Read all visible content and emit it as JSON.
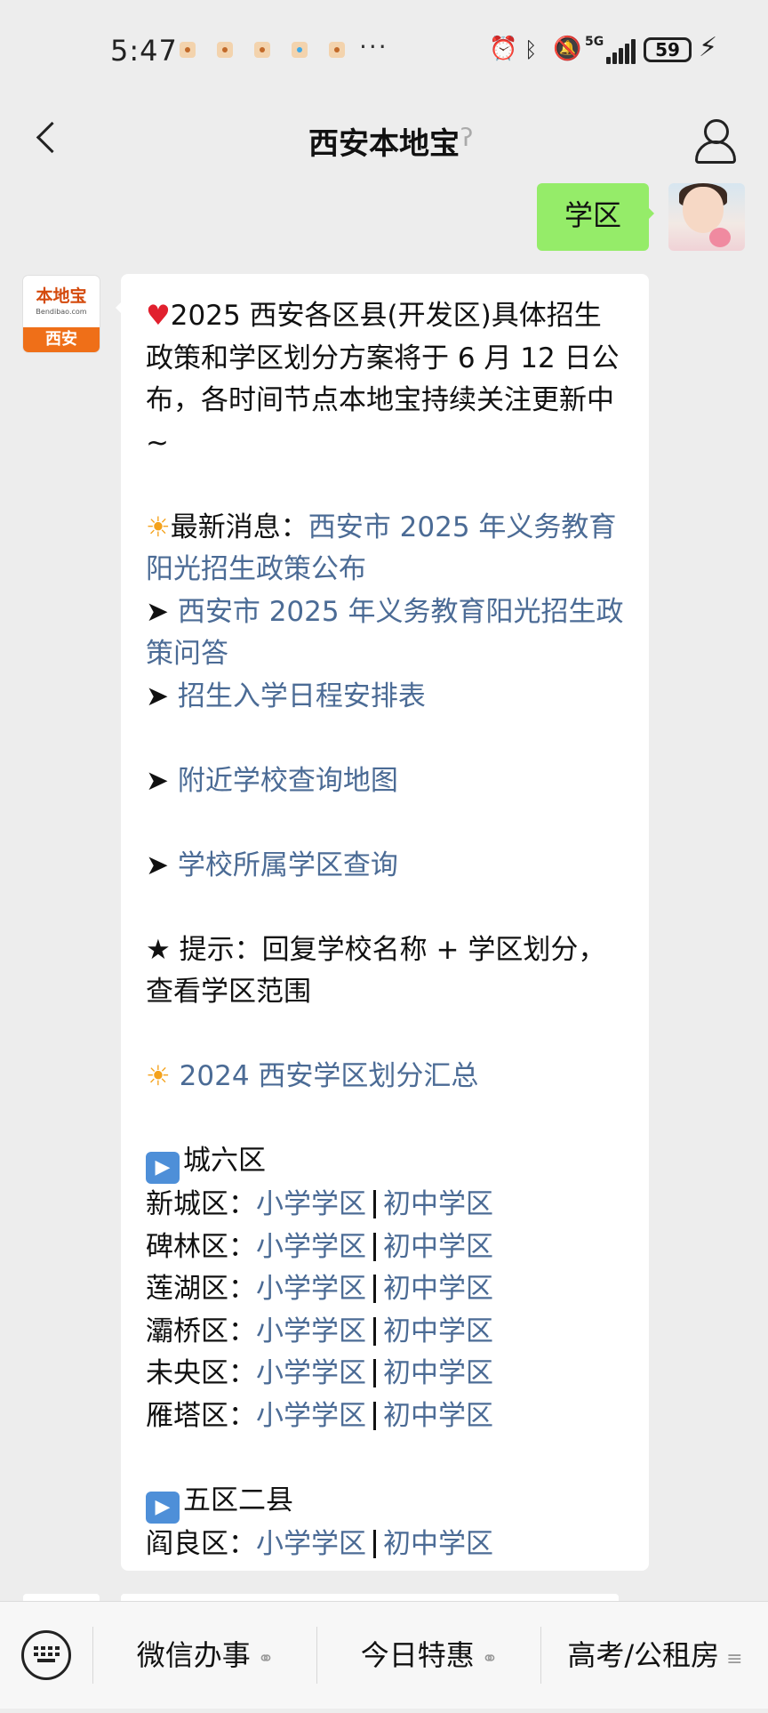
{
  "status_bar": {
    "time": "5:47",
    "more": "···",
    "network": "5G",
    "battery": "59"
  },
  "nav": {
    "title": "西安本地宝"
  },
  "chat": {
    "outgoing_message": "学区",
    "bot_avatar": {
      "logo_text": "本地宝",
      "logo_url": "Bendibao.com",
      "city": "西安"
    },
    "reply": {
      "intro": "2025 西安各区县(开发区)具体招生政策和学区划分方案将于 6 月 12 日公布，各时间节点本地宝持续关注更新中 ~",
      "latest_label": "最新消息：",
      "latest_link": "西安市 2025 年义务教育阳光招生政策公布",
      "arrow": "➤",
      "links": [
        "西安市 2025 年义务教育阳光招生政策问答",
        "招生入学日程安排表",
        "附近学校查询地图",
        "学校所属学区查询"
      ],
      "tip": "★ 提示：回复学校名称 + 学区划分，查看学区范围",
      "summary_link": "2024 西安学区划分汇总",
      "group1_title": "城六区",
      "group2_title": "五区二县",
      "primary_label": "小学学区",
      "middle_label": "初中学区",
      "districts_group1": [
        "新城区：",
        "碑林区：",
        "莲湖区：",
        "灞桥区：",
        "未央区：",
        "雁塔区："
      ],
      "districts_group2": [
        "阎良区："
      ]
    }
  },
  "bottom_menu": {
    "items": [
      "微信办事",
      "今日特惠",
      "高考/公租房"
    ]
  }
}
